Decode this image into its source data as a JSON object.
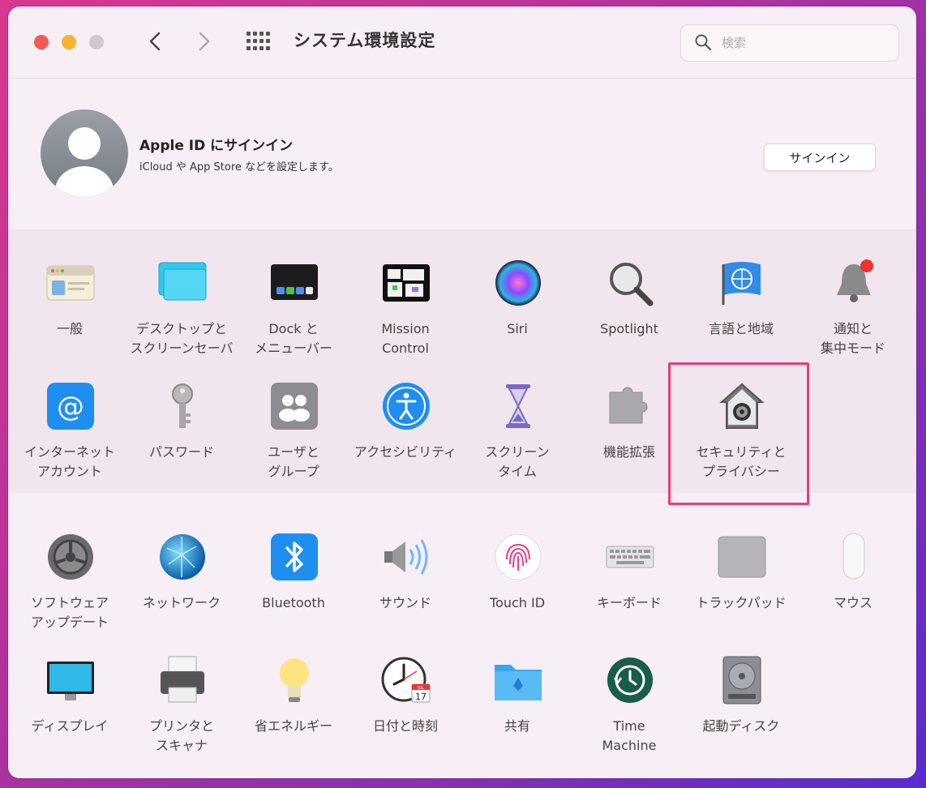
{
  "window": {
    "title": "システム環境設定"
  },
  "search": {
    "placeholder": "検索"
  },
  "apple_id": {
    "title": "Apple ID にサインイン",
    "subtitle": "iCloud や App Store などを設定します。",
    "button": "サインイン"
  },
  "prefs_row1": [
    {
      "label": "一般",
      "icon": "general-icon"
    },
    {
      "label": "デスクトップと\nスクリーンセーバ",
      "icon": "desktop-icon"
    },
    {
      "label": "Dock と\nメニューバー",
      "icon": "dock-icon"
    },
    {
      "label": "Mission\nControl",
      "icon": "mission-control-icon"
    },
    {
      "label": "Siri",
      "icon": "siri-icon"
    },
    {
      "label": "Spotlight",
      "icon": "spotlight-icon"
    },
    {
      "label": "言語と地域",
      "icon": "language-icon"
    },
    {
      "label": "通知と\n集中モード",
      "icon": "notifications-icon"
    }
  ],
  "prefs_row2": [
    {
      "label": "インターネット\nアカウント",
      "icon": "internet-accounts-icon"
    },
    {
      "label": "パスワード",
      "icon": "passwords-icon"
    },
    {
      "label": "ユーザと\nグループ",
      "icon": "users-icon"
    },
    {
      "label": "アクセシビリティ",
      "icon": "accessibility-icon"
    },
    {
      "label": "スクリーン\nタイム",
      "icon": "screen-time-icon"
    },
    {
      "label": "機能拡張",
      "icon": "extensions-icon"
    },
    {
      "label": "セキュリティと\nプライバシー",
      "icon": "security-icon"
    }
  ],
  "prefs_row3": [
    {
      "label": "ソフトウェア\nアップデート",
      "icon": "software-update-icon"
    },
    {
      "label": "ネットワーク",
      "icon": "network-icon"
    },
    {
      "label": "Bluetooth",
      "icon": "bluetooth-icon"
    },
    {
      "label": "サウンド",
      "icon": "sound-icon"
    },
    {
      "label": "Touch ID",
      "icon": "touch-id-icon"
    },
    {
      "label": "キーボード",
      "icon": "keyboard-icon"
    },
    {
      "label": "トラックパッド",
      "icon": "trackpad-icon"
    },
    {
      "label": "マウス",
      "icon": "mouse-icon"
    }
  ],
  "prefs_row4": [
    {
      "label": "ディスプレイ",
      "icon": "displays-icon"
    },
    {
      "label": "プリンタと\nスキャナ",
      "icon": "printers-icon"
    },
    {
      "label": "省エネルギー",
      "icon": "energy-saver-icon"
    },
    {
      "label": "日付と時刻",
      "icon": "date-time-icon"
    },
    {
      "label": "共有",
      "icon": "sharing-icon"
    },
    {
      "label": "Time\nMachine",
      "icon": "time-machine-icon"
    },
    {
      "label": "起動ディスク",
      "icon": "startup-disk-icon"
    }
  ],
  "date_icon_day": "17",
  "date_icon_month": "JUL",
  "colors": {
    "highlight": "#e83c7c"
  }
}
